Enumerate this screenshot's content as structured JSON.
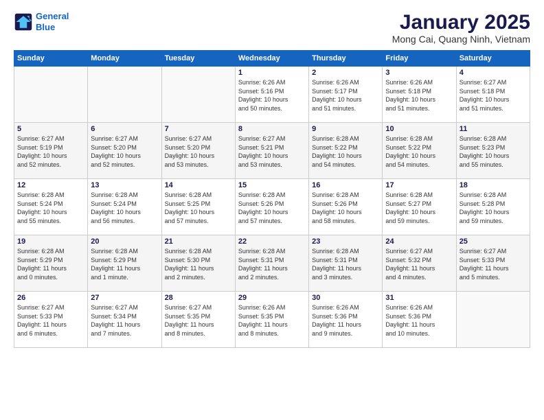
{
  "logo": {
    "line1": "General",
    "line2": "Blue"
  },
  "title": "January 2025",
  "subtitle": "Mong Cai, Quang Ninh, Vietnam",
  "days_header": [
    "Sunday",
    "Monday",
    "Tuesday",
    "Wednesday",
    "Thursday",
    "Friday",
    "Saturday"
  ],
  "weeks": [
    [
      {
        "day": "",
        "info": ""
      },
      {
        "day": "",
        "info": ""
      },
      {
        "day": "",
        "info": ""
      },
      {
        "day": "1",
        "info": "Sunrise: 6:26 AM\nSunset: 5:16 PM\nDaylight: 10 hours\nand 50 minutes."
      },
      {
        "day": "2",
        "info": "Sunrise: 6:26 AM\nSunset: 5:17 PM\nDaylight: 10 hours\nand 51 minutes."
      },
      {
        "day": "3",
        "info": "Sunrise: 6:26 AM\nSunset: 5:18 PM\nDaylight: 10 hours\nand 51 minutes."
      },
      {
        "day": "4",
        "info": "Sunrise: 6:27 AM\nSunset: 5:18 PM\nDaylight: 10 hours\nand 51 minutes."
      }
    ],
    [
      {
        "day": "5",
        "info": "Sunrise: 6:27 AM\nSunset: 5:19 PM\nDaylight: 10 hours\nand 52 minutes."
      },
      {
        "day": "6",
        "info": "Sunrise: 6:27 AM\nSunset: 5:20 PM\nDaylight: 10 hours\nand 52 minutes."
      },
      {
        "day": "7",
        "info": "Sunrise: 6:27 AM\nSunset: 5:20 PM\nDaylight: 10 hours\nand 53 minutes."
      },
      {
        "day": "8",
        "info": "Sunrise: 6:27 AM\nSunset: 5:21 PM\nDaylight: 10 hours\nand 53 minutes."
      },
      {
        "day": "9",
        "info": "Sunrise: 6:28 AM\nSunset: 5:22 PM\nDaylight: 10 hours\nand 54 minutes."
      },
      {
        "day": "10",
        "info": "Sunrise: 6:28 AM\nSunset: 5:22 PM\nDaylight: 10 hours\nand 54 minutes."
      },
      {
        "day": "11",
        "info": "Sunrise: 6:28 AM\nSunset: 5:23 PM\nDaylight: 10 hours\nand 55 minutes."
      }
    ],
    [
      {
        "day": "12",
        "info": "Sunrise: 6:28 AM\nSunset: 5:24 PM\nDaylight: 10 hours\nand 55 minutes."
      },
      {
        "day": "13",
        "info": "Sunrise: 6:28 AM\nSunset: 5:24 PM\nDaylight: 10 hours\nand 56 minutes."
      },
      {
        "day": "14",
        "info": "Sunrise: 6:28 AM\nSunset: 5:25 PM\nDaylight: 10 hours\nand 57 minutes."
      },
      {
        "day": "15",
        "info": "Sunrise: 6:28 AM\nSunset: 5:26 PM\nDaylight: 10 hours\nand 57 minutes."
      },
      {
        "day": "16",
        "info": "Sunrise: 6:28 AM\nSunset: 5:26 PM\nDaylight: 10 hours\nand 58 minutes."
      },
      {
        "day": "17",
        "info": "Sunrise: 6:28 AM\nSunset: 5:27 PM\nDaylight: 10 hours\nand 59 minutes."
      },
      {
        "day": "18",
        "info": "Sunrise: 6:28 AM\nSunset: 5:28 PM\nDaylight: 10 hours\nand 59 minutes."
      }
    ],
    [
      {
        "day": "19",
        "info": "Sunrise: 6:28 AM\nSunset: 5:29 PM\nDaylight: 11 hours\nand 0 minutes."
      },
      {
        "day": "20",
        "info": "Sunrise: 6:28 AM\nSunset: 5:29 PM\nDaylight: 11 hours\nand 1 minute."
      },
      {
        "day": "21",
        "info": "Sunrise: 6:28 AM\nSunset: 5:30 PM\nDaylight: 11 hours\nand 2 minutes."
      },
      {
        "day": "22",
        "info": "Sunrise: 6:28 AM\nSunset: 5:31 PM\nDaylight: 11 hours\nand 2 minutes."
      },
      {
        "day": "23",
        "info": "Sunrise: 6:28 AM\nSunset: 5:31 PM\nDaylight: 11 hours\nand 3 minutes."
      },
      {
        "day": "24",
        "info": "Sunrise: 6:27 AM\nSunset: 5:32 PM\nDaylight: 11 hours\nand 4 minutes."
      },
      {
        "day": "25",
        "info": "Sunrise: 6:27 AM\nSunset: 5:33 PM\nDaylight: 11 hours\nand 5 minutes."
      }
    ],
    [
      {
        "day": "26",
        "info": "Sunrise: 6:27 AM\nSunset: 5:33 PM\nDaylight: 11 hours\nand 6 minutes."
      },
      {
        "day": "27",
        "info": "Sunrise: 6:27 AM\nSunset: 5:34 PM\nDaylight: 11 hours\nand 7 minutes."
      },
      {
        "day": "28",
        "info": "Sunrise: 6:27 AM\nSunset: 5:35 PM\nDaylight: 11 hours\nand 8 minutes."
      },
      {
        "day": "29",
        "info": "Sunrise: 6:26 AM\nSunset: 5:35 PM\nDaylight: 11 hours\nand 8 minutes."
      },
      {
        "day": "30",
        "info": "Sunrise: 6:26 AM\nSunset: 5:36 PM\nDaylight: 11 hours\nand 9 minutes."
      },
      {
        "day": "31",
        "info": "Sunrise: 6:26 AM\nSunset: 5:36 PM\nDaylight: 11 hours\nand 10 minutes."
      },
      {
        "day": "",
        "info": ""
      }
    ]
  ]
}
